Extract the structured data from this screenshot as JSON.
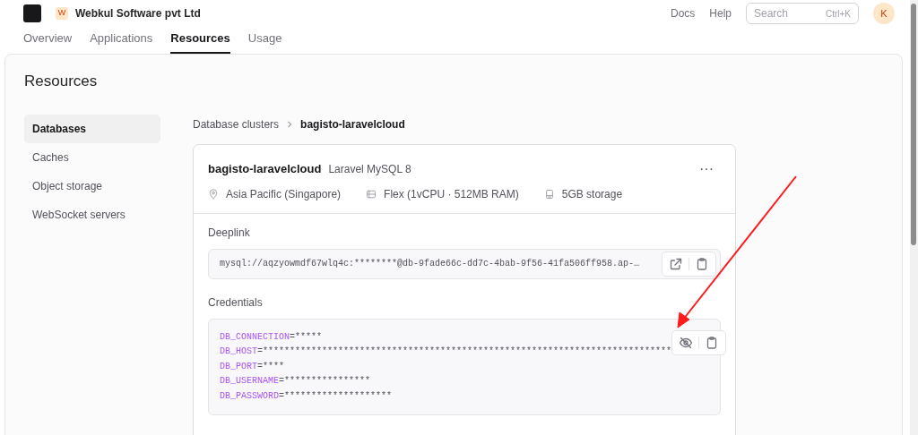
{
  "header": {
    "org": "Webkul Software pvt Ltd",
    "org_initial": "W",
    "links": [
      "Docs",
      "Help"
    ],
    "search": {
      "placeholder": "Search",
      "shortcut": "Ctrl+K"
    },
    "avatar": "K"
  },
  "tabs": [
    {
      "label": "Overview",
      "selected": false
    },
    {
      "label": "Applications",
      "selected": false
    },
    {
      "label": "Resources",
      "selected": true
    },
    {
      "label": "Usage",
      "selected": false
    }
  ],
  "page_title": "Resources",
  "sidebar": {
    "items": [
      {
        "label": "Databases",
        "selected": true
      },
      {
        "label": "Caches",
        "selected": false
      },
      {
        "label": "Object storage",
        "selected": false
      },
      {
        "label": "WebSocket servers",
        "selected": false
      }
    ]
  },
  "breadcrumb": [
    "Database clusters",
    "bagisto-laravelcloud"
  ],
  "cluster": {
    "name": "bagisto-laravelcloud",
    "engine": "Laravel MySQL 8",
    "more": "···",
    "meta": [
      {
        "kind": "location",
        "text": "Asia Pacific (Singapore)"
      },
      {
        "kind": "size",
        "text": "Flex (1vCPU · 512MB RAM)"
      },
      {
        "kind": "storage",
        "text": "5GB storage"
      }
    ],
    "deeplink": {
      "label": "Deeplink",
      "value": "mysql://aqzyowmdf67wlq4c:********@db-9fade66c-dd7c-4bab-9f56-41fa506ff958.ap-…"
    },
    "credentials": {
      "label": "Credentials",
      "revealed": false,
      "lines": [
        {
          "key": "DB_CONNECTION",
          "value": "=*****"
        },
        {
          "key": "DB_HOST",
          "value": "=****************************************************************************"
        },
        {
          "key": "DB_PORT",
          "value": "=****"
        },
        {
          "key": "DB_USERNAME",
          "value": "=****************"
        },
        {
          "key": "DB_PASSWORD",
          "value": "=********************"
        }
      ]
    }
  }
}
